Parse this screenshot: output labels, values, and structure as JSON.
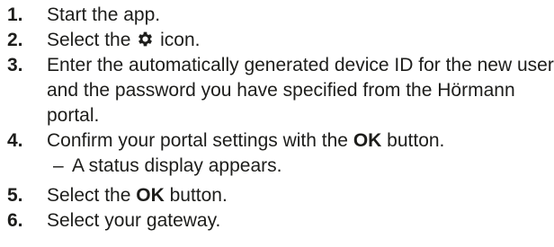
{
  "steps": [
    {
      "number": "1.",
      "text": "Start the app."
    },
    {
      "number": "2.",
      "before": "Select the",
      "icon": "gear-icon",
      "after": "icon."
    },
    {
      "number": "3.",
      "text": "Enter the automatically generated device ID for the new user and the password you have specified from the Hörmann portal."
    },
    {
      "number": "4.",
      "before": "Confirm your portal settings with the",
      "bold": "OK",
      "after": "button.",
      "sub": {
        "marker": "–",
        "text": "A status display appears."
      }
    },
    {
      "number": "5.",
      "before": "Select the",
      "bold": "OK",
      "after": "button."
    },
    {
      "number": "6.",
      "text": "Select your gateway."
    }
  ]
}
